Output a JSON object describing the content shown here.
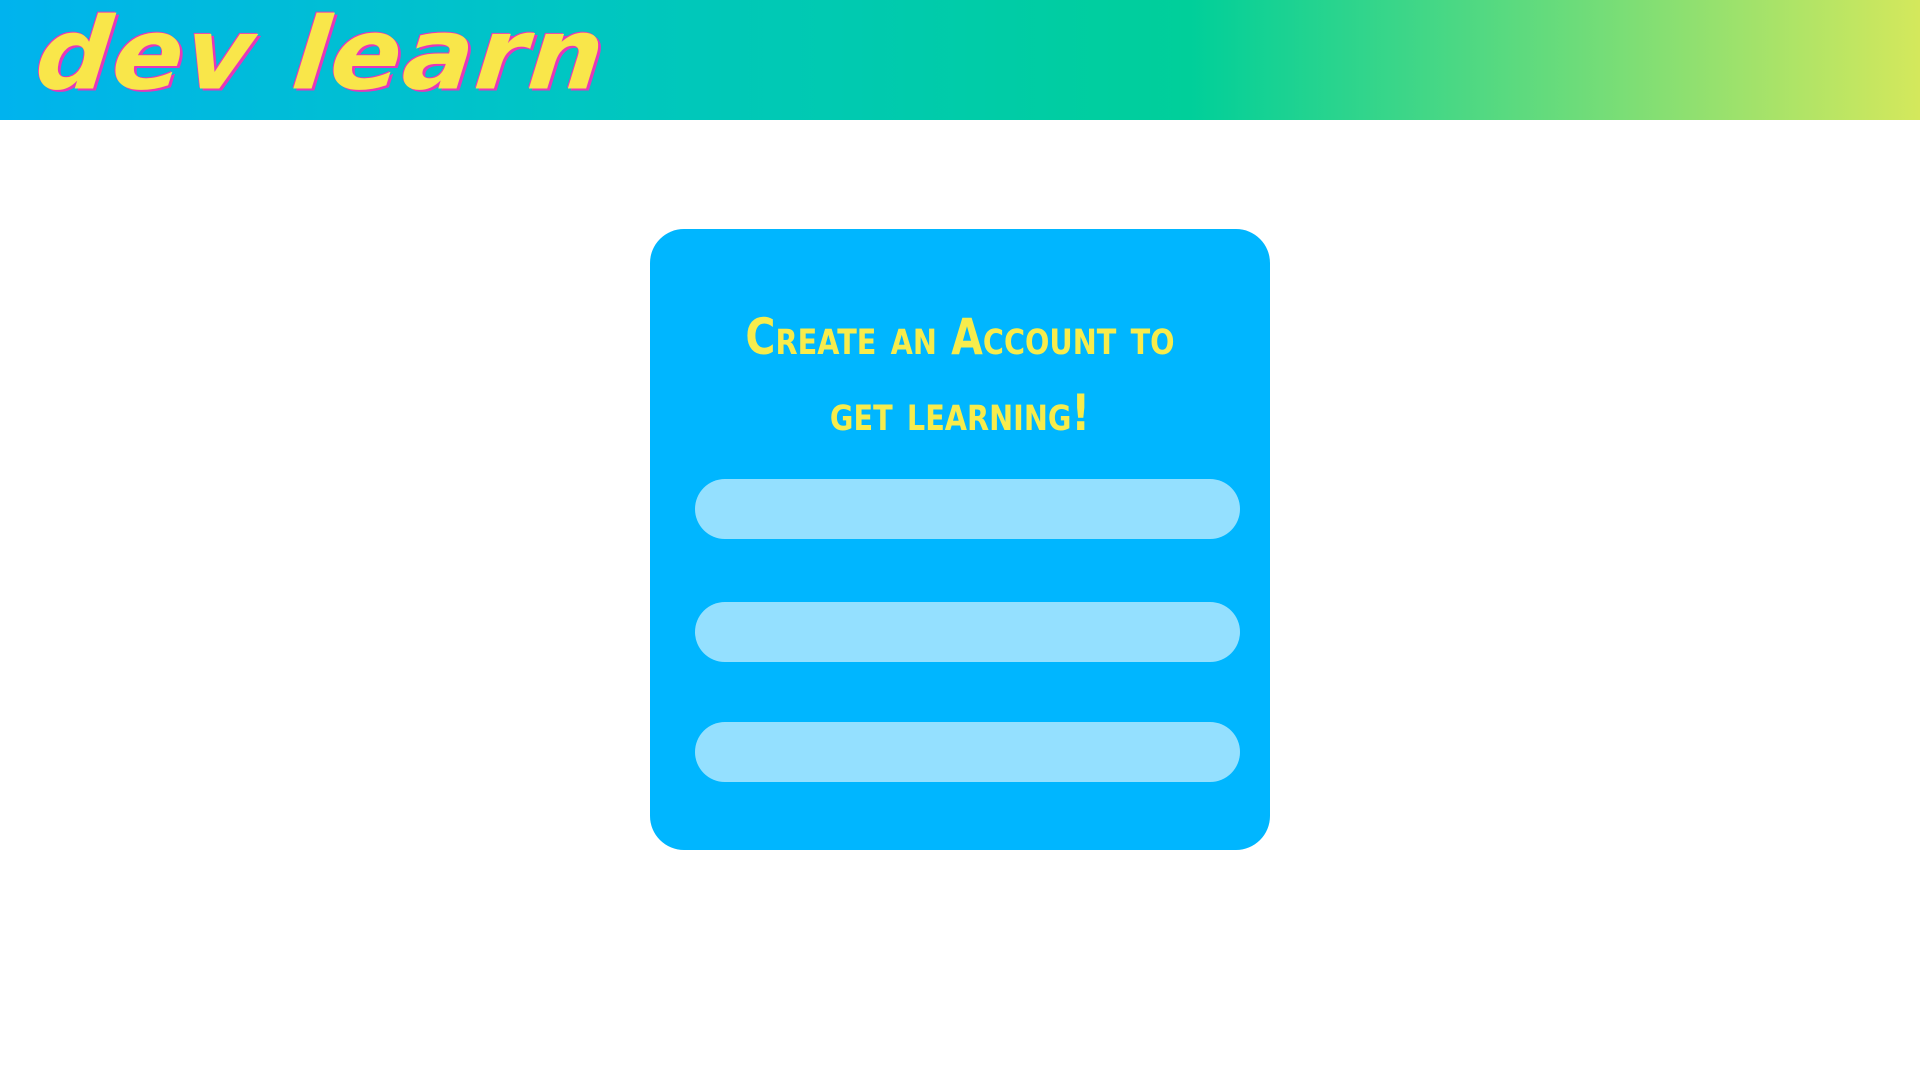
{
  "header": {
    "logo_text": "dev learn",
    "gradient_colors": [
      "#00b3ee",
      "#00c6c2",
      "#00cf9a",
      "#6cdc7a",
      "#d4e85c"
    ]
  },
  "signup_card": {
    "title_line1": "Create an Account to",
    "title_line2": "get learning!",
    "background_color": "#00b6ff",
    "title_color": "#f7ec4c",
    "fields": [
      {
        "value": "",
        "placeholder": ""
      },
      {
        "value": "",
        "placeholder": ""
      },
      {
        "value": "",
        "placeholder": ""
      }
    ],
    "field_color": "#94e0ff"
  }
}
